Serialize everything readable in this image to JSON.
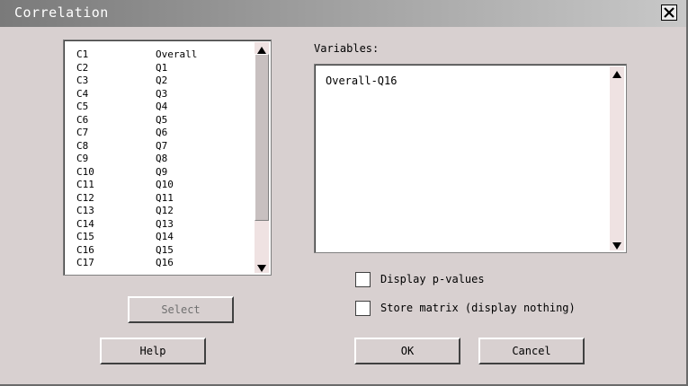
{
  "window": {
    "title": "Correlation",
    "close_glyph": "X"
  },
  "column_list": {
    "items": [
      {
        "id": "C1",
        "name": "Overall"
      },
      {
        "id": "C2",
        "name": "Q1"
      },
      {
        "id": "C3",
        "name": "Q2"
      },
      {
        "id": "C4",
        "name": "Q3"
      },
      {
        "id": "C5",
        "name": "Q4"
      },
      {
        "id": "C6",
        "name": "Q5"
      },
      {
        "id": "C7",
        "name": "Q6"
      },
      {
        "id": "C8",
        "name": "Q7"
      },
      {
        "id": "C9",
        "name": "Q8"
      },
      {
        "id": "C10",
        "name": "Q9"
      },
      {
        "id": "C11",
        "name": "Q10"
      },
      {
        "id": "C12",
        "name": "Q11"
      },
      {
        "id": "C13",
        "name": "Q12"
      },
      {
        "id": "C14",
        "name": "Q13"
      },
      {
        "id": "C15",
        "name": "Q14"
      },
      {
        "id": "C16",
        "name": "Q15"
      },
      {
        "id": "C17",
        "name": "Q16"
      }
    ],
    "scroll_icons": {
      "up": "scroll-up-arrow-icon",
      "down": "scroll-down-arrow-icon"
    }
  },
  "variables": {
    "label": "Variables:",
    "value": "Overall-Q16"
  },
  "options": {
    "display_p_values": {
      "label": "Display p-values",
      "checked": false
    },
    "store_matrix": {
      "label": "Store matrix (display nothing)",
      "checked": false
    }
  },
  "buttons": {
    "select": {
      "label": "Select",
      "enabled": false
    },
    "help": {
      "label": "Help"
    },
    "ok": {
      "label": "OK"
    },
    "cancel": {
      "label": "Cancel"
    }
  }
}
